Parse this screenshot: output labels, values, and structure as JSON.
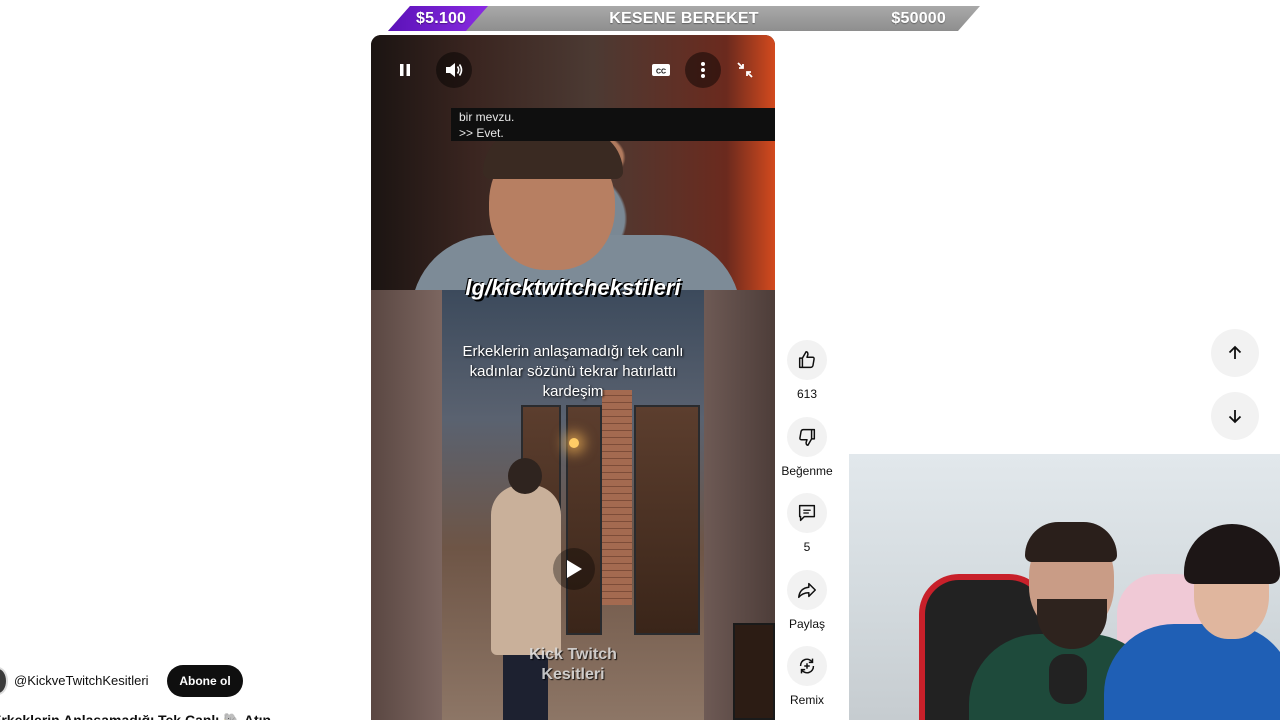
{
  "goal_banner": {
    "left": "$5.100",
    "center": "KESENE BEREKET",
    "right": "$50000",
    "accent_color": "#6a1bd1"
  },
  "player": {
    "captions": [
      "bir mevzu.",
      ">> Evet."
    ],
    "channel_overlay_text": "lg/kicktwitchekstileri",
    "inner_video_title": "Erkeklerin anlaşamadığı tek canlı kadınlar sözünü tekrar hatırlattı kardeşim",
    "watermark_line1": "Kick Twitch",
    "watermark_line2": "Kesitleri",
    "controls": [
      "pause-icon",
      "volume-icon",
      "cc-icon",
      "more-vert-icon",
      "exit-fullscreen-icon"
    ]
  },
  "actions": {
    "like_count": "613",
    "dislike_label": "Beğenme",
    "comment_count": "5",
    "share_label": "Paylaş",
    "remix_label": "Remix"
  },
  "channel": {
    "handle": "@KickveTwitchKesitleri",
    "subscribe_label": "Abone ol",
    "video_title": "Erkeklerin Anlaşamadığı Tek Canlı 🐘 Atın"
  }
}
